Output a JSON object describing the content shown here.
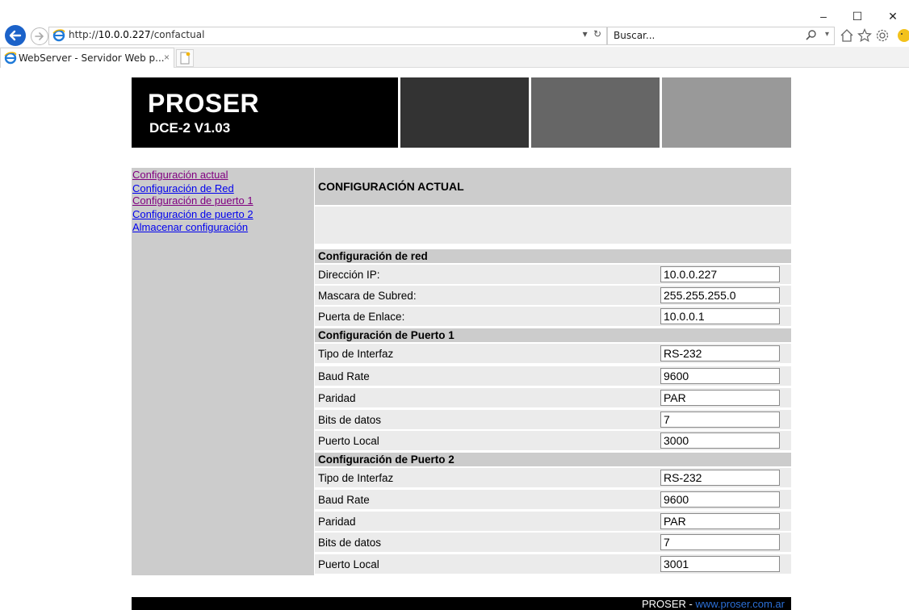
{
  "browser": {
    "address_prefix": "http://",
    "address_host": "10.0.0.227",
    "address_path": "/confactual",
    "search_placeholder": "Buscar...",
    "tab_title": "WebServer - Servidor Web p...",
    "window_minimize": "–",
    "window_maximize": "☐",
    "window_close": "✕"
  },
  "header": {
    "brand": "PROSER",
    "model": "DCE-2 V1.03",
    "block_colors": [
      "#333333",
      "#666666",
      "#999999"
    ]
  },
  "sidebar": {
    "items": [
      {
        "label": "Configuración actual",
        "visited": true
      },
      {
        "label": "Configuración de Red",
        "visited": false
      },
      {
        "label": "Configuración de puerto 1",
        "visited": true
      },
      {
        "label": "Configuración de puerto 2",
        "visited": false
      },
      {
        "label": "Almacenar configuración",
        "visited": false
      }
    ]
  },
  "main": {
    "title": "CONFIGURACIÓN ACTUAL",
    "groups": [
      {
        "title": "Configuración de red",
        "rows": [
          {
            "label": "Dirección IP:",
            "value": "10.0.0.227"
          },
          {
            "label": "Mascara de Subred:",
            "value": "255.255.255.0"
          },
          {
            "label": "Puerta de Enlace:",
            "value": "10.0.0.1"
          }
        ]
      },
      {
        "title": "Configuración de Puerto 1",
        "rows": [
          {
            "label": "Tipo de Interfaz",
            "value": "RS-232"
          },
          {
            "label": "Baud Rate",
            "value": "9600"
          },
          {
            "label": "Paridad",
            "value": "PAR"
          },
          {
            "label": "Bits de datos",
            "value": "7"
          },
          {
            "label": "Puerto Local",
            "value": "3000"
          }
        ]
      },
      {
        "title": "Configuración de Puerto 2",
        "rows": [
          {
            "label": "Tipo de Interfaz",
            "value": "RS-232"
          },
          {
            "label": "Baud Rate",
            "value": "9600"
          },
          {
            "label": "Paridad",
            "value": "PAR"
          },
          {
            "label": "Bits de datos",
            "value": "7"
          },
          {
            "label": "Puerto Local",
            "value": "3001"
          }
        ]
      }
    ]
  },
  "footer": {
    "company": "PROSER",
    "separator": " - ",
    "link": "www.proser.com.ar"
  },
  "colors": {
    "link_visited": "#800080",
    "link_unvisited": "#0000ee",
    "footer_link": "#2b6fd6"
  }
}
